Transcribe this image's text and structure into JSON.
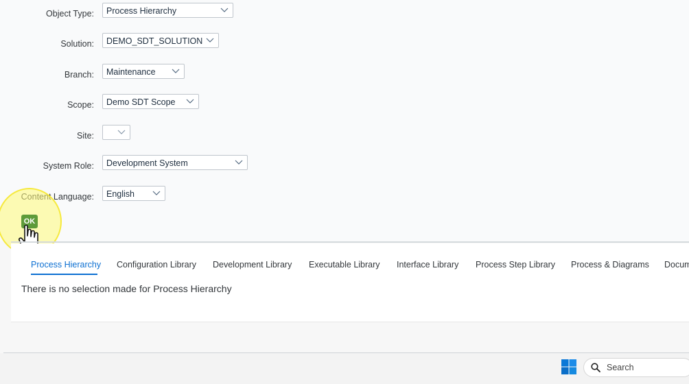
{
  "form": {
    "object_type": {
      "label": "Object Type:",
      "value": "Process Hierarchy"
    },
    "solution": {
      "label": "Solution:",
      "value": "DEMO_SDT_SOLUTION"
    },
    "branch": {
      "label": "Branch:",
      "value": "Maintenance"
    },
    "scope": {
      "label": "Scope:",
      "value": "Demo SDT Scope"
    },
    "site": {
      "label": "Site:",
      "value": ""
    },
    "system_role": {
      "label": "System Role:",
      "value": "Development System"
    },
    "content_language": {
      "label": "Content Language:",
      "value": "English"
    },
    "ok_label": "OK"
  },
  "tabs": [
    {
      "label": "Process Hierarchy",
      "active": true
    },
    {
      "label": "Configuration Library"
    },
    {
      "label": "Development Library"
    },
    {
      "label": "Executable Library"
    },
    {
      "label": "Interface Library"
    },
    {
      "label": "Process Step Library"
    },
    {
      "label": "Process & Diagrams"
    },
    {
      "label": "Docum"
    }
  ],
  "content": {
    "message": "There is no selection made for Process Hierarchy"
  },
  "taskbar": {
    "search_label": "Search"
  },
  "colors": {
    "accent": "#0a6ed1",
    "ok_button": "#5e9b3a",
    "highlight": "#f5e628"
  }
}
